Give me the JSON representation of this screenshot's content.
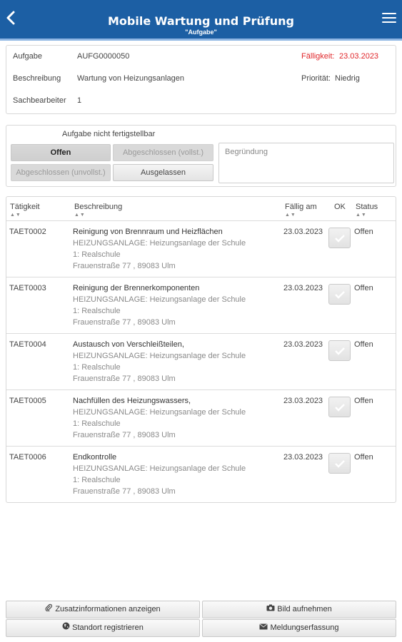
{
  "header": {
    "title": "Mobile Wartung und Prüfung",
    "subtitle": "\"Aufgabe\""
  },
  "task_info": {
    "task_label": "Aufgabe",
    "task_value": "AUFG0000050",
    "due_label": "Fälligkeit:",
    "due_value": "23.03.2023",
    "description_label": "Beschreibung",
    "description_value": "Wartung von Heizungsanlagen",
    "priority_label": "Priorität:",
    "priority_value": "Niedrig",
    "clerk_label": "Sachbearbeiter",
    "clerk_value": "1"
  },
  "status_panel": {
    "caption": "Aufgabe nicht fertigstellbar",
    "buttons": {
      "open": "Offen",
      "completed_full": "Abgeschlossen (vollst.)",
      "completed_partial": "Abgeschlossen (unvollst.)",
      "skipped": "Ausgelassen"
    },
    "reason_placeholder": "Begründung"
  },
  "table": {
    "headers": {
      "activity": "Tätigkeit",
      "description": "Beschreibung",
      "due": "Fällig am",
      "ok": "OK",
      "status": "Status"
    },
    "sort_glyph": "▲▼",
    "rows": [
      {
        "id": "TAET0002",
        "title": "Reinigung von Brennraum und Heizflächen",
        "sub1": "HEIZUNGSANLAGE: Heizungsanlage der Schule",
        "sub2": "1: Realschule",
        "sub3": "Frauenstraße 77 , 89083 Ulm",
        "due": "23.03.2023",
        "status": "Offen"
      },
      {
        "id": "TAET0003",
        "title": "Reinigung der Brennerkomponenten",
        "sub1": "HEIZUNGSANLAGE: Heizungsanlage der Schule",
        "sub2": "1: Realschule",
        "sub3": "Frauenstraße 77 , 89083 Ulm",
        "due": "23.03.2023",
        "status": "Offen"
      },
      {
        "id": "TAET0004",
        "title": "Austausch von Verschleißteilen,",
        "sub1": "HEIZUNGSANLAGE: Heizungsanlage der Schule",
        "sub2": "1: Realschule",
        "sub3": "Frauenstraße 77 , 89083 Ulm",
        "due": "23.03.2023",
        "status": "Offen"
      },
      {
        "id": "TAET0005",
        "title": "Nachfüllen des Heizungswassers,",
        "sub1": "HEIZUNGSANLAGE: Heizungsanlage der Schule",
        "sub2": "1: Realschule",
        "sub3": "Frauenstraße 77 , 89083 Ulm",
        "due": "23.03.2023",
        "status": "Offen"
      },
      {
        "id": "TAET0006",
        "title": "Endkontrolle",
        "sub1": "HEIZUNGSANLAGE: Heizungsanlage der Schule",
        "sub2": "1: Realschule",
        "sub3": "Frauenstraße 77 , 89083 Ulm",
        "due": "23.03.2023",
        "status": "Offen"
      }
    ]
  },
  "footer": {
    "additional_info": "Zusatzinformationen anzeigen",
    "take_photo": "Bild aufnehmen",
    "register_location": "Standort registrieren",
    "report": "Meldungserfassung"
  },
  "colors": {
    "header_bg": "#1c5fa4",
    "accent_red": "#e0262a"
  },
  "icons": {
    "back": "chevron-left-icon",
    "menu": "hamburger-menu-icon",
    "check": "checkmark-icon",
    "paperclip": "paperclip-icon",
    "camera": "camera-icon",
    "globe": "globe-icon",
    "envelope": "envelope-icon"
  }
}
